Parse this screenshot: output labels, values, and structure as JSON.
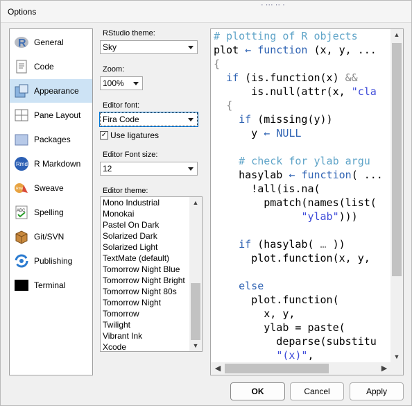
{
  "window": {
    "title": "Options",
    "deco": "·  ···  ··  ·"
  },
  "sidebar": {
    "items": [
      {
        "label": "General",
        "icon": "r-logo-icon"
      },
      {
        "label": "Code",
        "icon": "code-document-icon"
      },
      {
        "label": "Appearance",
        "icon": "appearance-icon"
      },
      {
        "label": "Pane Layout",
        "icon": "pane-layout-icon"
      },
      {
        "label": "Packages",
        "icon": "packages-icon"
      },
      {
        "label": "R Markdown",
        "icon": "rmarkdown-icon"
      },
      {
        "label": "Sweave",
        "icon": "sweave-icon"
      },
      {
        "label": "Spelling",
        "icon": "spelling-icon"
      },
      {
        "label": "Git/SVN",
        "icon": "git-svn-icon"
      },
      {
        "label": "Publishing",
        "icon": "publishing-icon"
      },
      {
        "label": "Terminal",
        "icon": "terminal-icon"
      }
    ],
    "selected": "Appearance"
  },
  "form": {
    "theme_label": "RStudio theme:",
    "theme_value": "Sky",
    "zoom_label": "Zoom:",
    "zoom_value": "100%",
    "font_label": "Editor font:",
    "font_value": "Fira Code",
    "ligatures_label": "Use ligatures",
    "ligatures_checked": true,
    "font_size_label": "Editor Font size:",
    "font_size_value": "12",
    "editor_theme_label": "Editor theme:",
    "themes": [
      "Mono Industrial",
      "Monokai",
      "Pastel On Dark",
      "Solarized Dark",
      "Solarized Light",
      "TextMate (default)",
      "Tomorrow Night Blue",
      "Tomorrow Night Bright",
      "Tomorrow Night 80s",
      "Tomorrow Night",
      "Tomorrow",
      "Twilight",
      "Vibrant Ink",
      "Xcode"
    ]
  },
  "preview": {
    "colors": {
      "comment": "#5fa4c8",
      "keyword": "#2f63b3",
      "string": "#3c49d8",
      "paren": "#888888",
      "text": "#000000"
    },
    "lines": [
      [
        [
          "comment",
          "# plotting of R objects"
        ]
      ],
      [
        [
          "text",
          "plot "
        ],
        [
          "keyword",
          "←"
        ],
        [
          "text",
          " "
        ],
        [
          "keyword",
          "function"
        ],
        [
          "text",
          " (x, y, ..."
        ]
      ],
      [
        [
          "paren",
          "{"
        ]
      ],
      [
        [
          "text",
          "  "
        ],
        [
          "keyword",
          "if"
        ],
        [
          "text",
          " (is.function(x) "
        ],
        [
          "paren",
          "&&"
        ]
      ],
      [
        [
          "text",
          "      is.null(attr(x, "
        ],
        [
          "string",
          "\"cla"
        ]
      ],
      [
        [
          "text",
          "  "
        ],
        [
          "paren",
          "{"
        ]
      ],
      [
        [
          "text",
          "    "
        ],
        [
          "keyword",
          "if"
        ],
        [
          "text",
          " (missing(y))"
        ]
      ],
      [
        [
          "text",
          "      y "
        ],
        [
          "keyword",
          "←"
        ],
        [
          "text",
          " "
        ],
        [
          "keyword",
          "NULL"
        ]
      ],
      [
        [
          "text",
          ""
        ]
      ],
      [
        [
          "text",
          "    "
        ],
        [
          "comment",
          "# check for ylab argu"
        ]
      ],
      [
        [
          "text",
          "    hasylab "
        ],
        [
          "keyword",
          "←"
        ],
        [
          "text",
          " "
        ],
        [
          "keyword",
          "function"
        ],
        [
          "text",
          "( ..."
        ]
      ],
      [
        [
          "text",
          "      !all(is.na("
        ]
      ],
      [
        [
          "text",
          "        pmatch(names(list("
        ]
      ],
      [
        [
          "text",
          "              "
        ],
        [
          "string",
          "\"ylab\""
        ],
        [
          "text",
          ")))"
        ]
      ],
      [
        [
          "text",
          ""
        ]
      ],
      [
        [
          "text",
          "    "
        ],
        [
          "keyword",
          "if"
        ],
        [
          "text",
          " (hasylab( "
        ],
        [
          "paren",
          "…"
        ],
        [
          "text",
          " ))"
        ]
      ],
      [
        [
          "text",
          "      plot.function(x, y,"
        ]
      ],
      [
        [
          "text",
          ""
        ]
      ],
      [
        [
          "text",
          "    "
        ],
        [
          "keyword",
          "else"
        ]
      ],
      [
        [
          "text",
          "      plot.function("
        ]
      ],
      [
        [
          "text",
          "        x, y,"
        ]
      ],
      [
        [
          "text",
          "        ylab = paste("
        ]
      ],
      [
        [
          "text",
          "          deparse(substitu"
        ]
      ],
      [
        [
          "text",
          "          "
        ],
        [
          "string",
          "\"(x)\""
        ],
        [
          "text",
          ","
        ]
      ]
    ]
  },
  "buttons": {
    "ok": "OK",
    "cancel": "Cancel",
    "apply": "Apply"
  }
}
